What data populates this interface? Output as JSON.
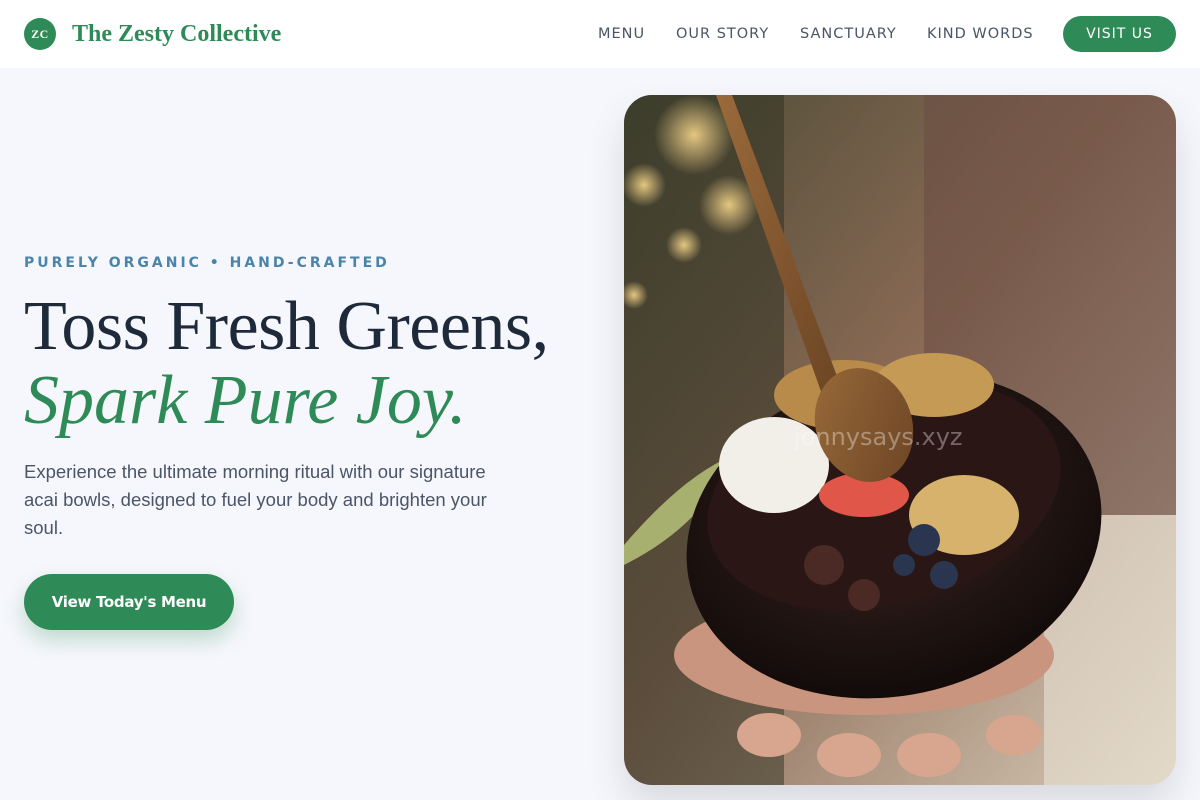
{
  "brand": {
    "initials": "ZC",
    "name": "The Zesty Collective",
    "color": "#2e8b57"
  },
  "nav": {
    "items": [
      "MENU",
      "OUR STORY",
      "SANCTUARY",
      "KIND WORDS"
    ],
    "cta_label": "VISIT US"
  },
  "hero": {
    "eyebrow": "PURELY ORGANIC • HAND-CRAFTED",
    "headline_line1": "Toss Fresh Greens,",
    "headline_line2": "Spark Pure Joy.",
    "description": "Experience the ultimate morning ritual with our signature acai bowls, designed to fuel your body and brighten your soul.",
    "cta_label": "View Today's Menu",
    "image_watermark": "jonnysays.xyz",
    "image_icon": "acai-bowl-photo"
  },
  "colors": {
    "accent": "#2e8b57",
    "heading": "#1e2a3a",
    "eyebrow": "#4a84a8",
    "body_text": "#4a5568",
    "background": "#f6f7fc"
  }
}
